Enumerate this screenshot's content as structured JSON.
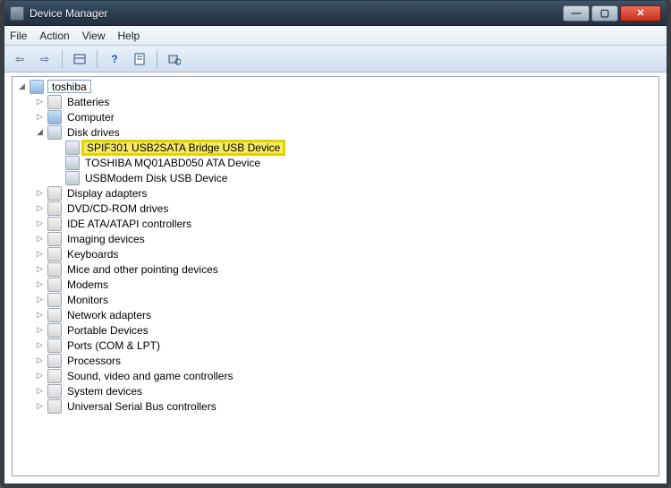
{
  "window": {
    "title": "Device Manager"
  },
  "menu": {
    "file": "File",
    "action": "Action",
    "view": "View",
    "help": "Help"
  },
  "tree": {
    "root": "toshiba",
    "batteries": "Batteries",
    "computer": "Computer",
    "disk_drives": "Disk drives",
    "disk_children": {
      "spif": "SPIF301 USB2SATA Bridge USB Device",
      "toshiba_ata": "TOSHIBA MQ01ABD050 ATA Device",
      "usbmodem": "USBModem Disk USB Device"
    },
    "display_adapters": "Display adapters",
    "dvd": "DVD/CD-ROM drives",
    "ide": "IDE ATA/ATAPI controllers",
    "imaging": "Imaging devices",
    "keyboards": "Keyboards",
    "mice": "Mice and other pointing devices",
    "modems": "Modems",
    "monitors": "Monitors",
    "network": "Network adapters",
    "portable": "Portable Devices",
    "ports": "Ports (COM & LPT)",
    "processors": "Processors",
    "sound": "Sound, video and game controllers",
    "system": "System devices",
    "usb": "Universal Serial Bus controllers"
  },
  "glyphs": {
    "expand": "▷",
    "collapse": "◢",
    "minimize": "—",
    "maximize": "▢",
    "close": "✕",
    "back": "⇦",
    "forward": "⇨",
    "help": "?"
  }
}
